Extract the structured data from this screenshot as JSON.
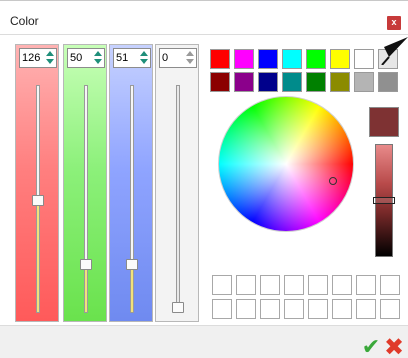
{
  "window": {
    "title": "Color",
    "close_label": "x"
  },
  "channels": [
    {
      "name": "red",
      "value": "126",
      "level": 0.494
    },
    {
      "name": "green",
      "value": "50",
      "level": 0.196
    },
    {
      "name": "blue",
      "value": "51",
      "level": 0.2
    },
    {
      "name": "alpha",
      "value": "0",
      "level": 0.0
    }
  ],
  "palette": {
    "row1": [
      "#ff0000",
      "#ff00ff",
      "#0000ff",
      "#00ffff",
      "#00ff00",
      "#ffff00",
      "#ffffff",
      "#e6e6e6"
    ],
    "row2": [
      "#8b0000",
      "#8b008b",
      "#00008b",
      "#008b8b",
      "#008000",
      "#8b8b00",
      "#b4b4b4",
      "#909090"
    ]
  },
  "current_color": "#7e3233",
  "custom_colors_count": 16,
  "actions": {
    "ok_symbol": "✔",
    "cancel_symbol": "✖"
  }
}
